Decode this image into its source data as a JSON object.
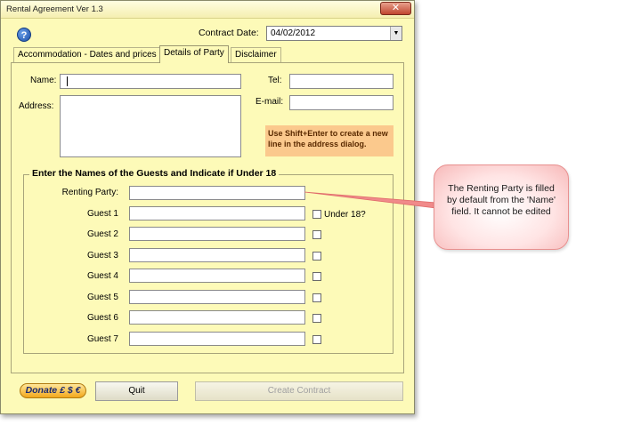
{
  "window": {
    "title": "Rental Agreement Ver 1.3",
    "close_glyph": "✕"
  },
  "help": {
    "glyph": "?"
  },
  "contract_date": {
    "label": "Contract Date:",
    "value": "04/02/2012",
    "arrow": "▼"
  },
  "tabs": [
    {
      "label": "Accommodation - Dates and prices",
      "active": false
    },
    {
      "label": "Details of Party",
      "active": true
    },
    {
      "label": "Disclaimer",
      "active": false
    }
  ],
  "party": {
    "name_label": "Name:",
    "name_value": "",
    "address_label": "Address:",
    "address_value": "",
    "tel_label": "Tel:",
    "tel_value": "",
    "email_label": "E-mail:",
    "email_value": "",
    "note": "Use Shift+Enter to create a new line in the address dialog."
  },
  "guests": {
    "frame_title": "Enter the Names of the Guests and Indicate if Under 18",
    "renting_party_label": "Renting Party:",
    "renting_party_value": "",
    "under18_label": "Under 18?",
    "rows": [
      {
        "label": "Guest 1",
        "value": "",
        "under18": false
      },
      {
        "label": "Guest 2",
        "value": "",
        "under18": false
      },
      {
        "label": "Guest 3",
        "value": "",
        "under18": false
      },
      {
        "label": "Guest 4",
        "value": "",
        "under18": false
      },
      {
        "label": "Guest 5",
        "value": "",
        "under18": false
      },
      {
        "label": "Guest 6",
        "value": "",
        "under18": false
      },
      {
        "label": "Guest 7",
        "value": "",
        "under18": false
      }
    ]
  },
  "buttons": {
    "donate": "Donate £ $ €",
    "quit": "Quit",
    "create_contract": "Create Contract"
  },
  "callout": {
    "text": "The Renting Party is filled by default from the 'Name' field. It cannot be edited",
    "color": "#f7b9b9"
  }
}
